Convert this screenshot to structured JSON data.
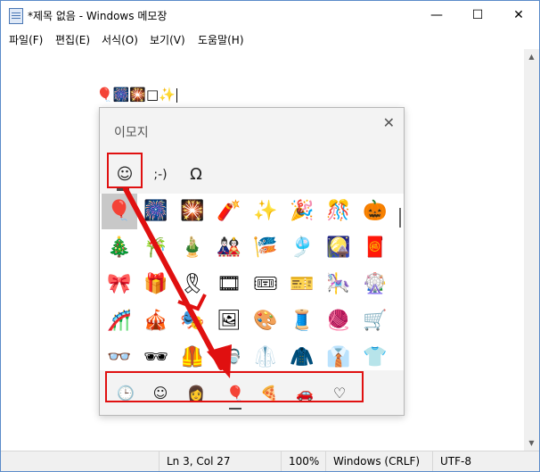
{
  "window": {
    "title": "*제목 없음 - Windows 메모장",
    "minimize": "—",
    "maximize": "☐",
    "close": "✕"
  },
  "menu": [
    "파일(F)",
    "편집(E)",
    "서식(O)",
    "보기(V)",
    "도움말(H)"
  ],
  "editor": {
    "content": "🎈🎆🎇□✨"
  },
  "emoji_panel": {
    "title": "이모지",
    "close": "✕",
    "tabs": [
      "☺",
      ";-)",
      "Ω"
    ],
    "rows": [
      [
        "🎈",
        "🎆",
        "🎇",
        "🧨",
        "✨",
        "🎉",
        "🎊",
        "🎃"
      ],
      [
        "🎄",
        "🎋",
        "🎍",
        "🎎",
        "🎏",
        "🎐",
        "🎑",
        "🧧"
      ],
      [
        "🎀",
        "🎁",
        "🎗",
        "🎞",
        "🎟",
        "🎫",
        "🎠",
        "🎡"
      ],
      [
        "🎢",
        "🎪",
        "🎭",
        "🖼",
        "🎨",
        "🧵",
        "🧶",
        "🛒"
      ],
      [
        "👓",
        "🕶",
        "🦺",
        "🥽",
        "🥼",
        "🧥",
        "👔",
        "👕"
      ]
    ],
    "bottom_tabs": [
      "🕒",
      "☺",
      "👩",
      "🎈",
      "🍕",
      "🚗",
      "♡"
    ]
  },
  "status": {
    "position": "Ln 3, Col 27",
    "zoom": "100%",
    "eol": "Windows (CRLF)",
    "encoding": "UTF-8"
  },
  "colors": {
    "highlight": "#e01010",
    "selected": "#c8c8c8"
  }
}
